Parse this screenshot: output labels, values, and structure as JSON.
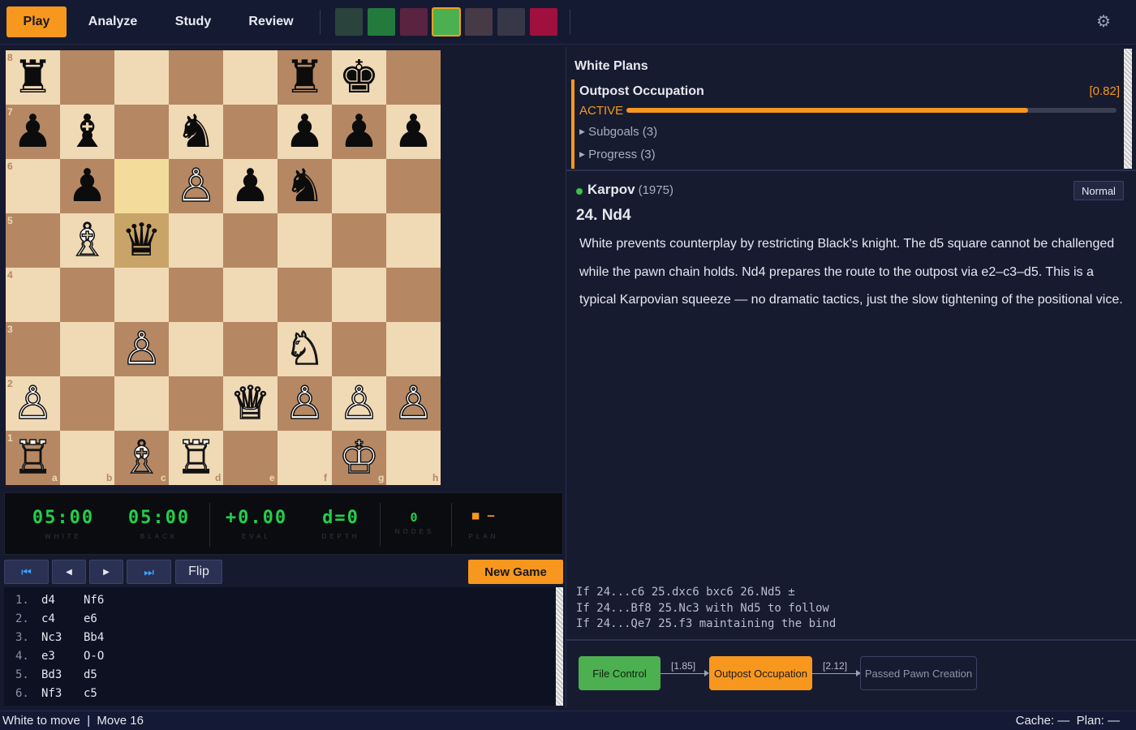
{
  "nav": {
    "tabs": [
      {
        "label": "Play",
        "active": true
      },
      {
        "label": "Analyze"
      },
      {
        "label": "Study"
      },
      {
        "label": "Review"
      }
    ],
    "swatches": [
      "#2a433c",
      "#237a3c",
      "#5a2340",
      "#4cb050",
      "#463a46",
      "#363848",
      "#a0103f"
    ],
    "selected_swatch": 3,
    "settings_icon": "gear-icon"
  },
  "board": {
    "files": [
      "a",
      "b",
      "c",
      "d",
      "e",
      "f",
      "g",
      "h"
    ],
    "ranks": [
      "8",
      "7",
      "6",
      "5",
      "4",
      "3",
      "2",
      "1"
    ],
    "highlight": [
      "c6",
      "c5"
    ],
    "pieces": [
      {
        "sq": "a8",
        "glyph": "♜",
        "color": "b"
      },
      {
        "sq": "f8",
        "glyph": "♜",
        "color": "b"
      },
      {
        "sq": "g8",
        "glyph": "♚",
        "color": "b"
      },
      {
        "sq": "a7",
        "glyph": "♟",
        "color": "b"
      },
      {
        "sq": "b7",
        "glyph": "♝",
        "color": "b"
      },
      {
        "sq": "d7",
        "glyph": "♞",
        "color": "b"
      },
      {
        "sq": "f7",
        "glyph": "♟",
        "color": "b"
      },
      {
        "sq": "g7",
        "glyph": "♟",
        "color": "b"
      },
      {
        "sq": "h7",
        "glyph": "♟",
        "color": "b"
      },
      {
        "sq": "b6",
        "glyph": "♟",
        "color": "b"
      },
      {
        "sq": "d6",
        "glyph": "♙",
        "color": "w"
      },
      {
        "sq": "e6",
        "glyph": "♟",
        "color": "b"
      },
      {
        "sq": "f6",
        "glyph": "♞",
        "color": "b"
      },
      {
        "sq": "b5",
        "glyph": "♗",
        "color": "w"
      },
      {
        "sq": "c5",
        "glyph": "♛",
        "color": "b"
      },
      {
        "sq": "c3",
        "glyph": "♙",
        "color": "w"
      },
      {
        "sq": "f3",
        "glyph": "♘",
        "color": "w"
      },
      {
        "sq": "a2",
        "glyph": "♙",
        "color": "w"
      },
      {
        "sq": "e2",
        "glyph": "♕",
        "color": "w"
      },
      {
        "sq": "f2",
        "glyph": "♙",
        "color": "w"
      },
      {
        "sq": "g2",
        "glyph": "♙",
        "color": "w"
      },
      {
        "sq": "h2",
        "glyph": "♙",
        "color": "w"
      },
      {
        "sq": "a1",
        "glyph": "♖",
        "color": "w"
      },
      {
        "sq": "c1",
        "glyph": "♗",
        "color": "w"
      },
      {
        "sq": "d1",
        "glyph": "♖",
        "color": "w"
      },
      {
        "sq": "g1",
        "glyph": "♔",
        "color": "w"
      }
    ]
  },
  "lcd": {
    "white_time": "05:00",
    "white_label": "WHITE",
    "black_time": "05:00",
    "black_label": "BLACK",
    "eval": "+0.00",
    "eval_label": "EVAL",
    "depth": "d=0",
    "depth_label": "DEPTH",
    "nodes": "0",
    "nodes_label": "NODES",
    "plan": "■ —",
    "plan_label": "PLAN"
  },
  "controls": {
    "first": "⏮",
    "prev": "◀",
    "next": "▶",
    "last": "⏭",
    "flip": "Flip",
    "new_game": "New Game"
  },
  "moves": [
    {
      "n": "1.",
      "w": "d4",
      "b": "Nf6"
    },
    {
      "n": "2.",
      "w": "c4",
      "b": "e6"
    },
    {
      "n": "3.",
      "w": "Nc3",
      "b": "Bb4"
    },
    {
      "n": "4.",
      "w": "e3",
      "b": "O-O"
    },
    {
      "n": "5.",
      "w": "Bd3",
      "b": "d5"
    },
    {
      "n": "6.",
      "w": "Nf3",
      "b": "c5"
    }
  ],
  "status": {
    "left": "White to move  |  Move 16",
    "right": "Cache: —  Plan: —"
  },
  "plans": {
    "title": "White Plans",
    "current": {
      "name": "Outpost Occupation",
      "score": "[0.82]",
      "state": "ACTIVE",
      "progress": 0.82
    },
    "subgoals": "Subgoals (3)",
    "progress_label": "Progress (3)"
  },
  "commentary": {
    "author": "Karpov",
    "year": "(1975)",
    "mode": "Normal",
    "move": "24. Nd4",
    "text": "White prevents counterplay by restricting Black's knight. The d5 square cannot be challenged while the pawn chain holds. Nd4 prepares the route to the outpost via e2–c3–d5. This is a typical Karpovian squeeze — no dramatic tactics, just the slow tightening of the positional vice."
  },
  "variations": [
    "If 24...c6 25.dxc6 bxc6 26.Nd5 ±",
    "If 24...Bf8 25.Nc3 with Nd5 to follow",
    "If 24...Qe7 25.f3 maintaining the bind"
  ],
  "flow": {
    "nodes": [
      {
        "label": "File Control",
        "state": "done"
      },
      {
        "label": "Outpost Occupation",
        "state": "cur"
      },
      {
        "label": "Passed Pawn Creation",
        "state": "next"
      }
    ],
    "edges": [
      "[1.85]",
      "[2.12]"
    ]
  },
  "colors": {
    "accent": "#f7971e",
    "good": "#4caf50",
    "lcd": "#22d04a"
  }
}
